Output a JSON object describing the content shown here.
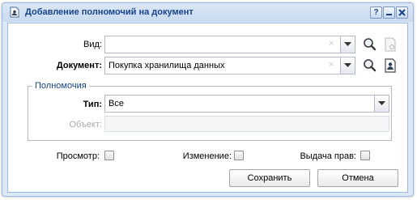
{
  "window": {
    "title": "Добавление полномочий на документ",
    "help_label": "?",
    "minimize_label": "–",
    "close_label": "x"
  },
  "form": {
    "kind": {
      "label": "Вид:",
      "value": "",
      "clear": "×"
    },
    "document": {
      "label": "Документ:",
      "value": "Покупка хранилища данных",
      "clear": "×"
    }
  },
  "permissions": {
    "legend": "Полномочия",
    "type": {
      "label": "Тип:",
      "value": "Все"
    },
    "object": {
      "label": "Объект:",
      "value": ""
    }
  },
  "rights": {
    "view_label": "Просмотр:",
    "edit_label": "Изменение:",
    "grant_label": "Выдача прав:"
  },
  "buttons": {
    "save_label": "Сохранить",
    "cancel_label": "Отмена"
  },
  "colors": {
    "title_text": "#15428b",
    "window_bg": "#dfe8f6",
    "border": "#99bbe8"
  }
}
